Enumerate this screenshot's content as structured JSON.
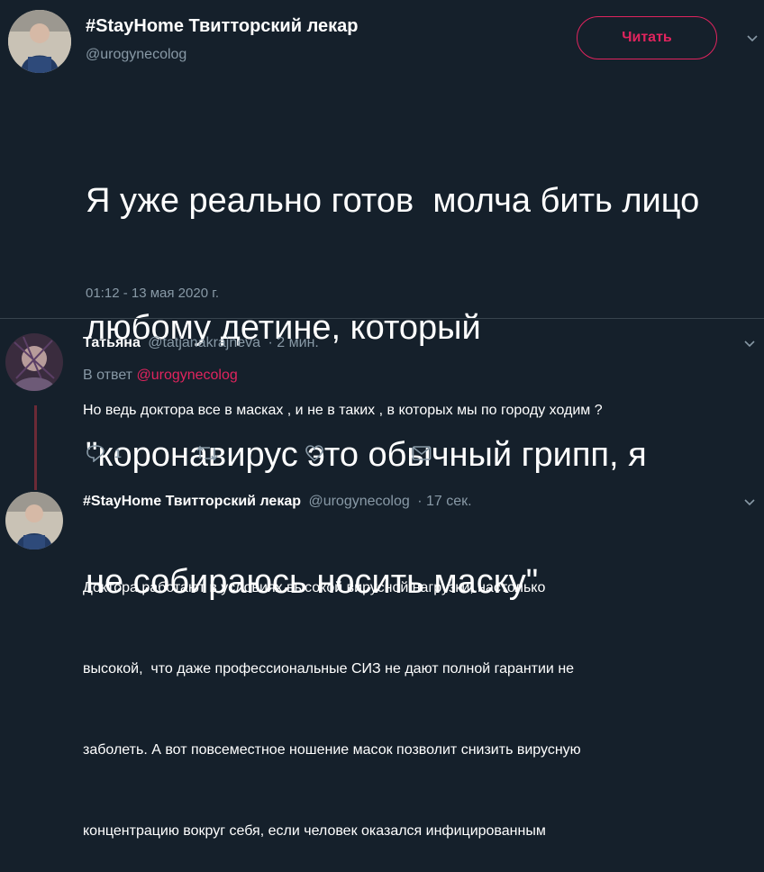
{
  "main_tweet": {
    "display_name": "#StayHome Твитторский лекар",
    "handle": "@urogynecolog",
    "follow_label": "Читать",
    "text_lines": [
      "Я уже реально готов  молча бить лицо",
      "любому детине, который",
      "\"коронавирус это обычный грипп, я",
      "не собираюсь носить маску\""
    ],
    "timestamp": "01:12 - 13 мая 2020 г."
  },
  "reply1": {
    "display_name": "Татьяна",
    "handle": "@tatjanakrajneva",
    "time": "· 2 мин.",
    "reply_to_prefix": "В ответ",
    "reply_to_handle": "@urogynecolog",
    "text": "Но ведь доктора все в масках , и не в таких , в которых мы по городу ходим ?",
    "reply_count": "1"
  },
  "reply2": {
    "display_name": "#StayHome Твитторский лекар",
    "handle": "@urogynecolog",
    "time": "· 17 сек.",
    "text_lines": [
      "Доктора работают в условиях высокой вирусной нагрузки, настолько",
      "высокой,  что даже профессиональные СИЗ не дают полной гарантии не",
      "заболеть. А вот повсеместное ношение масок позволит снизить вирусную",
      "концентрацию вокруг себя, если человек оказался инфицированным"
    ]
  },
  "colors": {
    "background": "#15202b",
    "accent": "#e0245e",
    "muted": "#8899a6",
    "divider": "#38444d"
  },
  "icons": [
    "chevron-down-icon",
    "reply-icon",
    "retweet-icon",
    "like-icon",
    "dm-icon"
  ]
}
